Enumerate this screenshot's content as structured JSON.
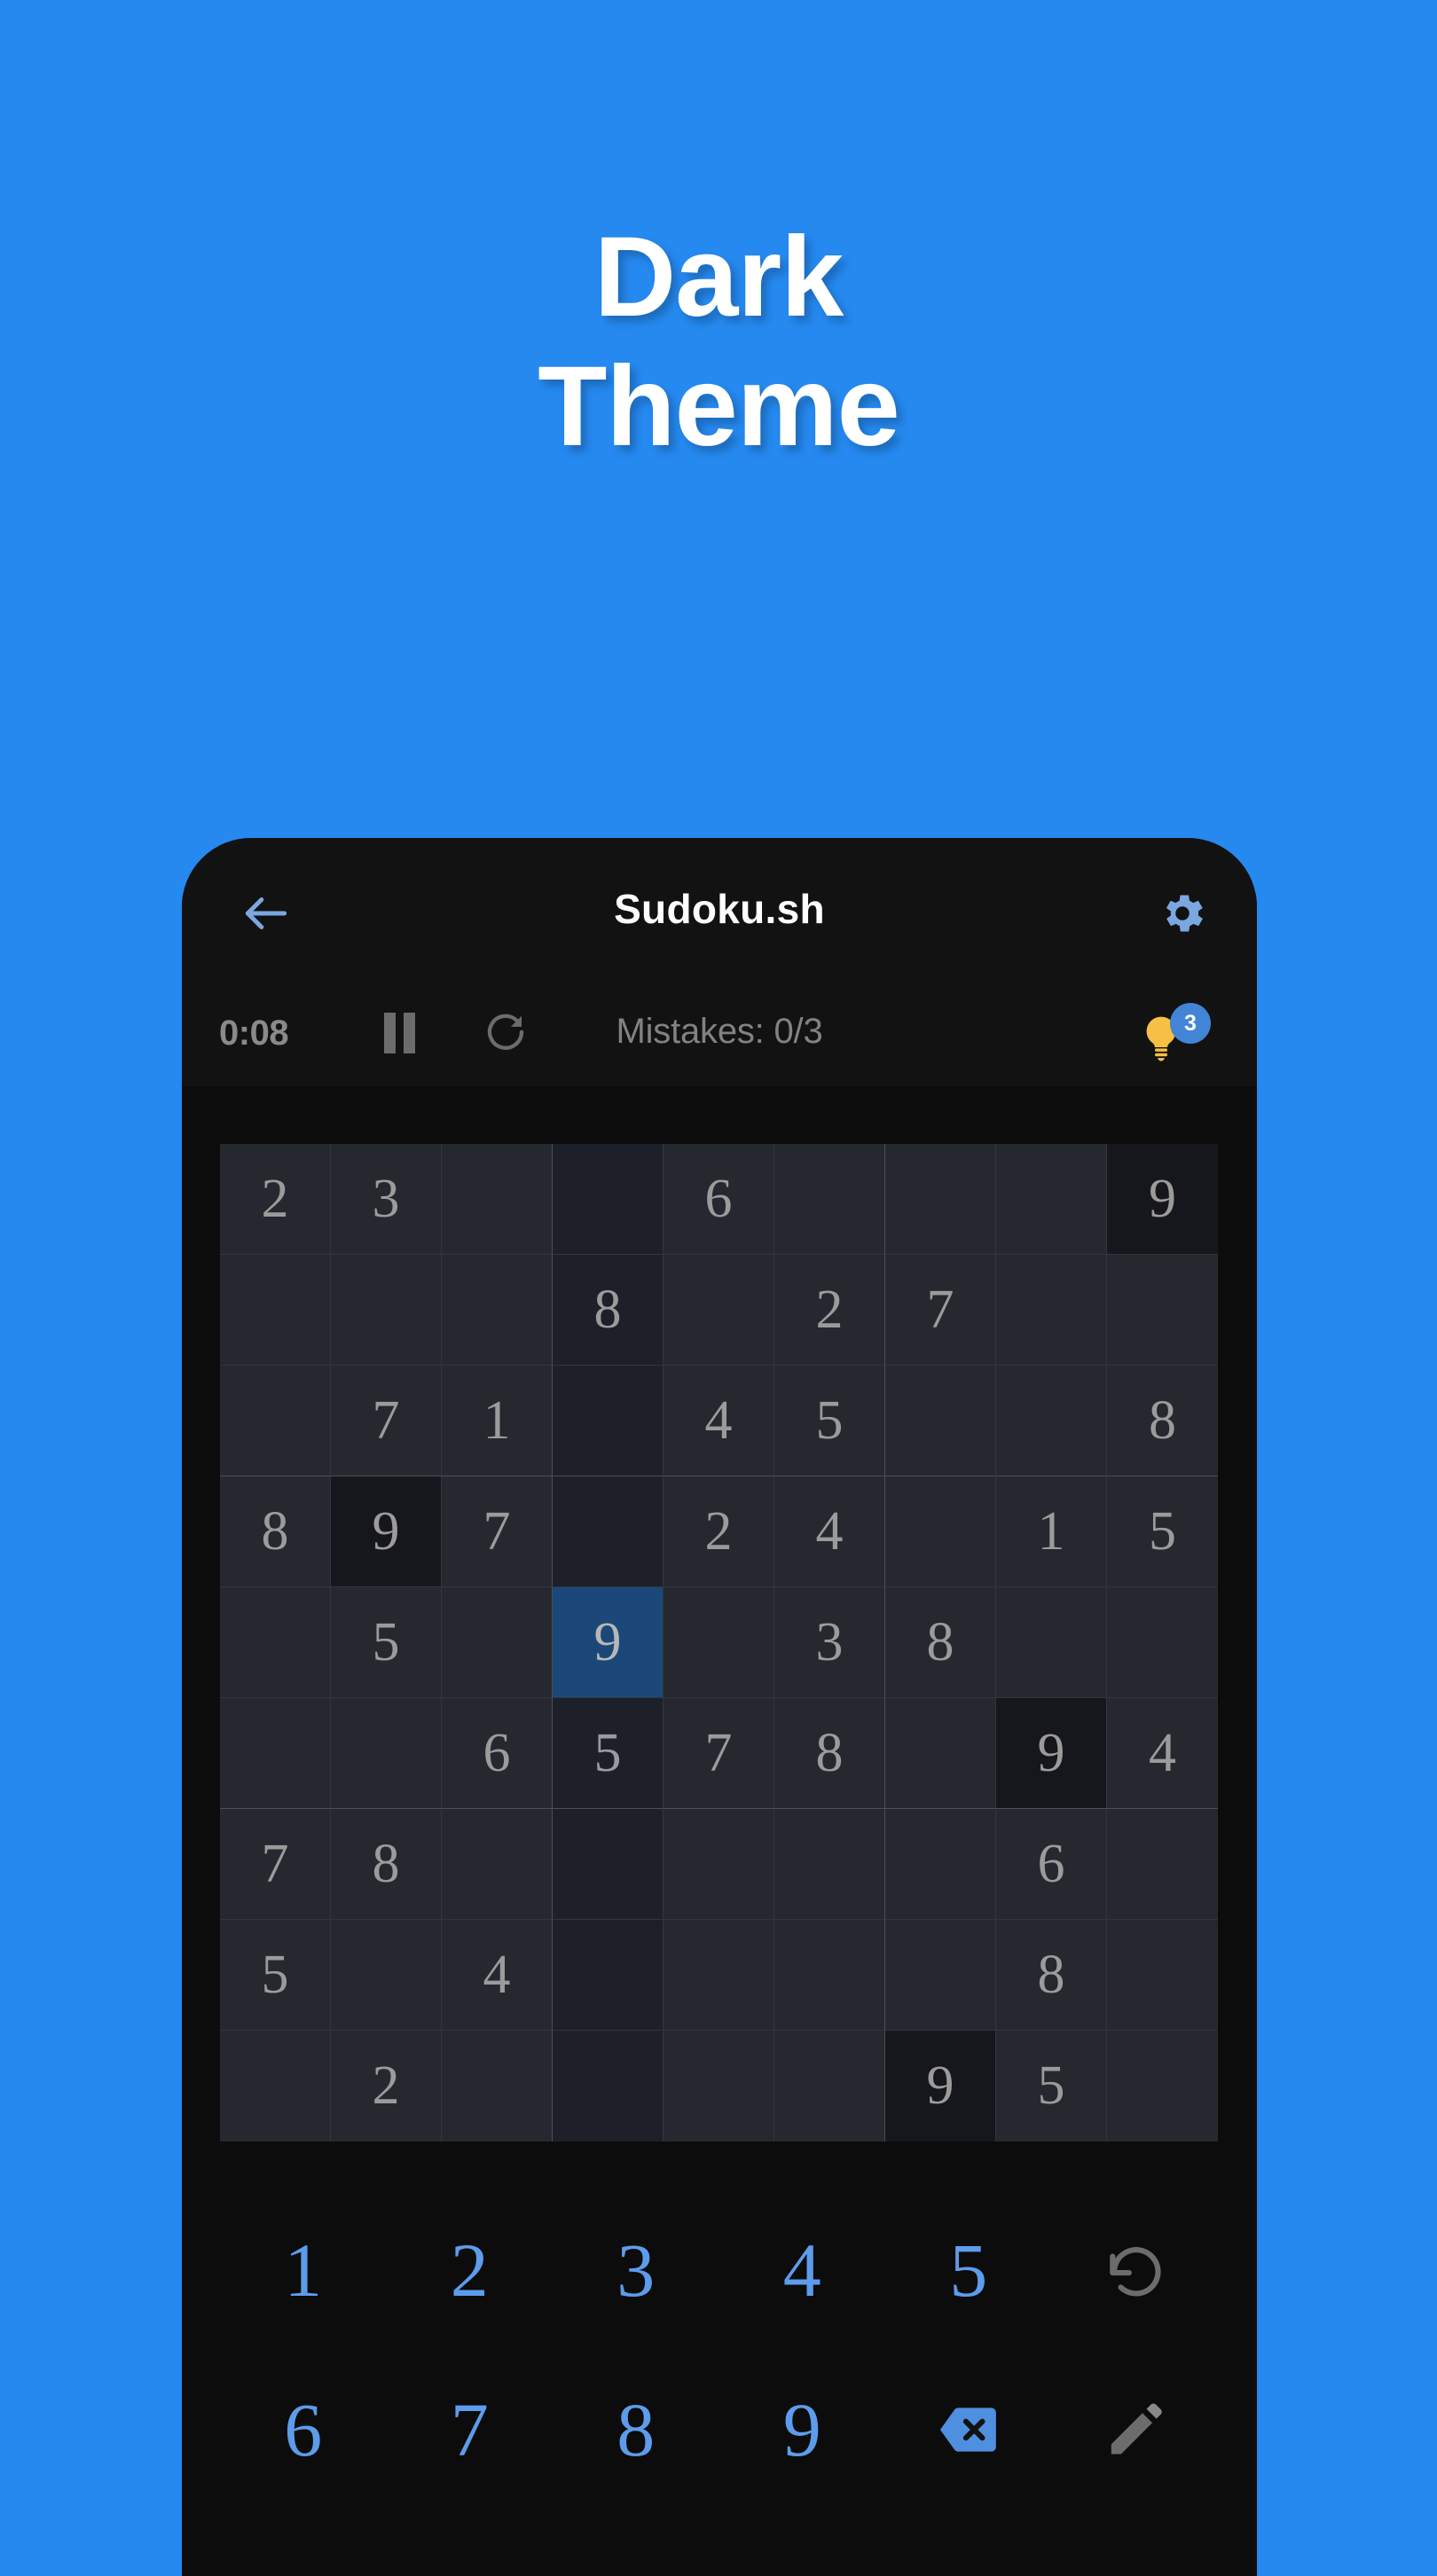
{
  "promo": {
    "headline_line1": "Dark",
    "headline_line2": "Theme",
    "background_color": "#2589f0",
    "text_color": "#ffffff"
  },
  "app": {
    "title": "Sudoku.sh",
    "back_icon": "arrow-left-icon",
    "settings_icon": "gear-icon",
    "accent_color": "#7ba7e0",
    "surface_color": "#121212"
  },
  "status": {
    "timer": "0:08",
    "pause_icon": "pause-icon",
    "restart_icon": "restart-icon",
    "mistakes": "Mistakes: 0/3",
    "hint_icon": "lightbulb-icon",
    "hint_count": "3",
    "hint_badge_color": "#4285d6",
    "bulb_color": "#f5c043"
  },
  "board": {
    "selected_cell": {
      "row": 5,
      "col": 4
    },
    "selected_color": "#1b4878",
    "cell_color": "#26282f",
    "digit_color": "#9b9b9b",
    "rows": [
      [
        "2",
        "3",
        "",
        "",
        "6",
        "",
        "",
        "",
        "9"
      ],
      [
        "",
        "",
        "",
        "8",
        "",
        "2",
        "7",
        "",
        ""
      ],
      [
        "",
        "7",
        "1",
        "",
        "4",
        "5",
        "",
        "",
        "8"
      ],
      [
        "8",
        "9",
        "7",
        "",
        "2",
        "4",
        "",
        "1",
        "5"
      ],
      [
        "",
        "5",
        "",
        "9",
        "",
        "3",
        "8",
        "",
        ""
      ],
      [
        "",
        "",
        "6",
        "5",
        "7",
        "8",
        "",
        "9",
        "4"
      ],
      [
        "7",
        "8",
        "",
        "",
        "",
        "",
        "",
        "6",
        ""
      ],
      [
        "5",
        "",
        "4",
        "",
        "",
        "",
        "",
        "8",
        ""
      ],
      [
        "",
        "2",
        "",
        "",
        "",
        "",
        "9",
        "5",
        ""
      ]
    ],
    "same_value_cells": [
      {
        "row": 1,
        "col": 9
      },
      {
        "row": 4,
        "col": 2
      },
      {
        "row": 6,
        "col": 8
      },
      {
        "row": 9,
        "col": 7
      }
    ]
  },
  "numpad": {
    "digit_color": "#5d9cec",
    "row1": [
      {
        "label": "1",
        "name": "numpad-key-1",
        "type": "digit"
      },
      {
        "label": "2",
        "name": "numpad-key-2",
        "type": "digit"
      },
      {
        "label": "3",
        "name": "numpad-key-3",
        "type": "digit"
      },
      {
        "label": "4",
        "name": "numpad-key-4",
        "type": "digit"
      },
      {
        "label": "5",
        "name": "numpad-key-5",
        "type": "digit"
      },
      {
        "label": "undo-icon",
        "name": "undo-button",
        "type": "icon"
      }
    ],
    "row2": [
      {
        "label": "6",
        "name": "numpad-key-6",
        "type": "digit"
      },
      {
        "label": "7",
        "name": "numpad-key-7",
        "type": "digit"
      },
      {
        "label": "8",
        "name": "numpad-key-8",
        "type": "digit"
      },
      {
        "label": "9",
        "name": "numpad-key-9",
        "type": "digit"
      },
      {
        "label": "backspace-icon",
        "name": "erase-button",
        "type": "icon"
      },
      {
        "label": "pencil-icon",
        "name": "notes-toggle-button",
        "type": "icon"
      }
    ]
  }
}
